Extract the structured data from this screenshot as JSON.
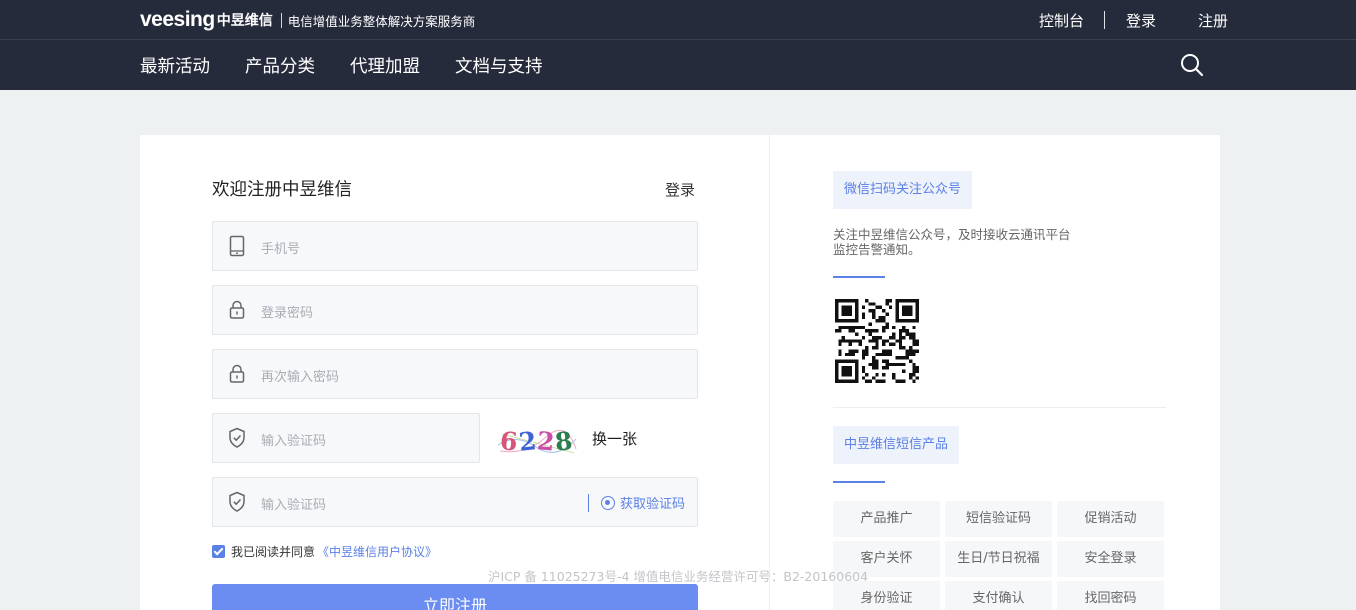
{
  "header": {
    "logo_word": "veesing",
    "logo_cn": "中昱维信",
    "slogan": "电信增值业务整体解决方案服务商",
    "links": {
      "console": "控制台",
      "login": "登录",
      "register": "注册"
    },
    "nav": [
      "最新活动",
      "产品分类",
      "代理加盟",
      "文档与支持"
    ],
    "search_icon": "search-icon"
  },
  "form": {
    "title": "欢迎注册中昱维信",
    "login_link": "登录",
    "phone": {
      "placeholder": "手机号",
      "icon": "phone-icon"
    },
    "password": {
      "placeholder": "登录密码",
      "icon": "lock-icon"
    },
    "password_confirm": {
      "placeholder": "再次输入密码",
      "icon": "lock-icon"
    },
    "captcha": {
      "placeholder": "输入验证码",
      "icon": "shield-icon",
      "image_text": "6228",
      "refresh": "换一张"
    },
    "sms_code": {
      "placeholder": "输入验证码",
      "icon": "shield-icon",
      "get_code": "获取验证码"
    },
    "agree": {
      "checked": true,
      "text": "我已阅读并同意",
      "link": "《中昱维信用户协议》"
    },
    "submit": "立即注册"
  },
  "sidebar": {
    "wechat_tag": "微信扫码关注公众号",
    "wechat_desc": "关注中昱维信公众号，及时接收云通讯平台监控告警通知。",
    "product_tag": "中昱维信短信产品",
    "products": [
      "产品推广",
      "短信验证码",
      "促销活动",
      "客户关怀",
      "生日/节日祝福",
      "安全登录",
      "身份验证",
      "支付确认",
      "找回密码"
    ]
  },
  "footer": {
    "text": "沪ICP 备 11025273号-4 增值电信业务经营许可号：B2-20160604"
  },
  "colors": {
    "header_bg": "#262b3c",
    "accent": "#5b80e6",
    "button": "#6b8cf0",
    "page_bg": "#eef1f2"
  }
}
